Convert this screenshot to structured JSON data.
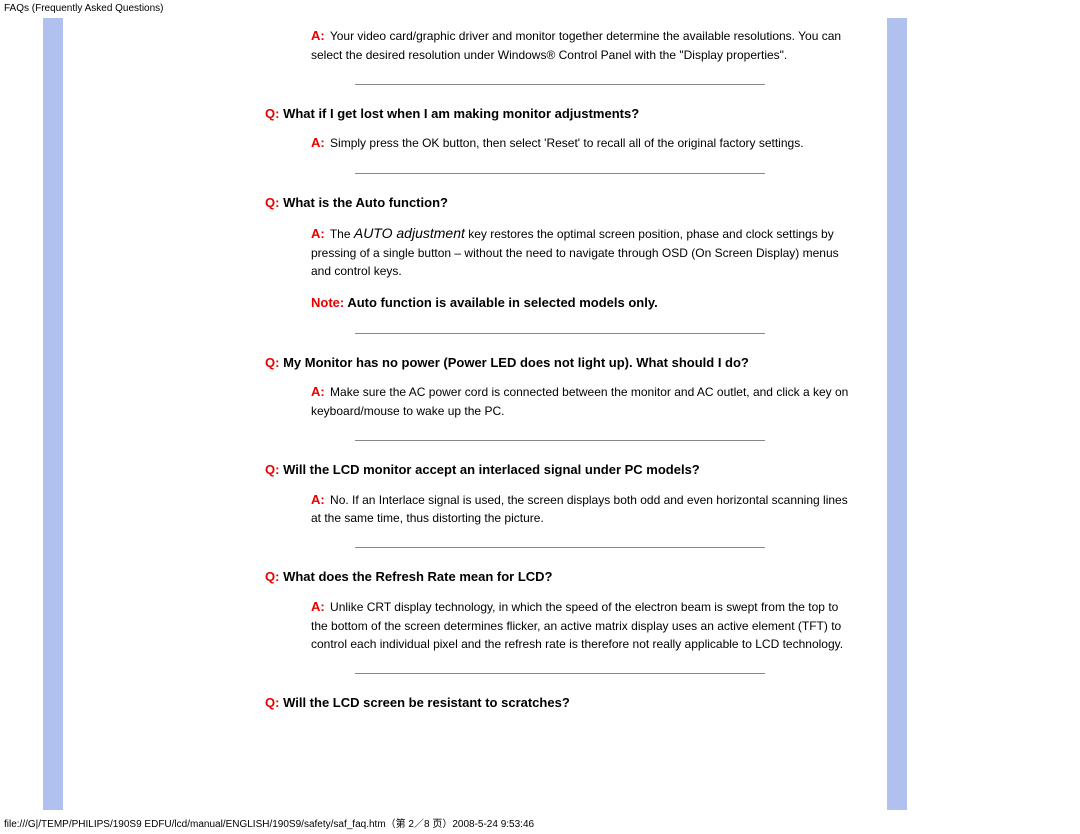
{
  "header": {
    "title": "FAQs (Frequently Asked Questions)"
  },
  "faq": {
    "a0_label": "A:",
    "a0_text": " Your video card/graphic driver and monitor together determine the available resolutions. You can select the desired resolution under Windows® Control Panel with the \"Display properties\".",
    "q1_label": "Q:",
    "q1_text": " What if I get lost when I am making monitor adjustments?",
    "a1_label": "A:",
    "a1_text": " Simply press the OK button, then select 'Reset' to recall all of the original factory settings.",
    "q2_label": "Q:",
    "q2_text": " What is the Auto function?",
    "a2_label": "A:",
    "a2_pre": " The ",
    "a2_italic": "AUTO adjustment",
    "a2_post": " key restores the optimal screen position, phase and clock settings by pressing of a single button – without the need to navigate through OSD (On Screen Display) menus and control keys.",
    "note_label": "Note:",
    "note_text": " Auto function is available in selected models only.",
    "q3_label": "Q:",
    "q3_text": " My Monitor has no power (Power LED does not light up). What should I do?",
    "a3_label": "A:",
    "a3_text": " Make sure the AC power cord is connected between the monitor and AC outlet, and click a key on keyboard/mouse to wake up the PC.",
    "q4_label": "Q:",
    "q4_text": " Will the LCD monitor accept an interlaced signal under PC models?",
    "a4_label": "A:",
    "a4_text": " No. If an Interlace signal is used, the screen displays both odd and even horizontal scanning lines at the same time, thus distorting the picture.",
    "q5_label": "Q:",
    "q5_text": " What does the Refresh Rate mean for LCD?",
    "a5_label": "A:",
    "a5_text": " Unlike CRT display technology, in which the speed of the electron beam is swept from the top to the bottom of the screen determines flicker, an active matrix display uses an active element (TFT) to control each individual pixel and the refresh rate is therefore not really applicable to LCD technology.",
    "q6_label": "Q:",
    "q6_text": " Will the LCD screen be resistant to scratches?"
  },
  "footer": {
    "path": "file:///G|/TEMP/PHILIPS/190S9 EDFU/lcd/manual/ENGLISH/190S9/safety/saf_faq.htm（第 2／8 页）2008-5-24 9:53:46"
  }
}
